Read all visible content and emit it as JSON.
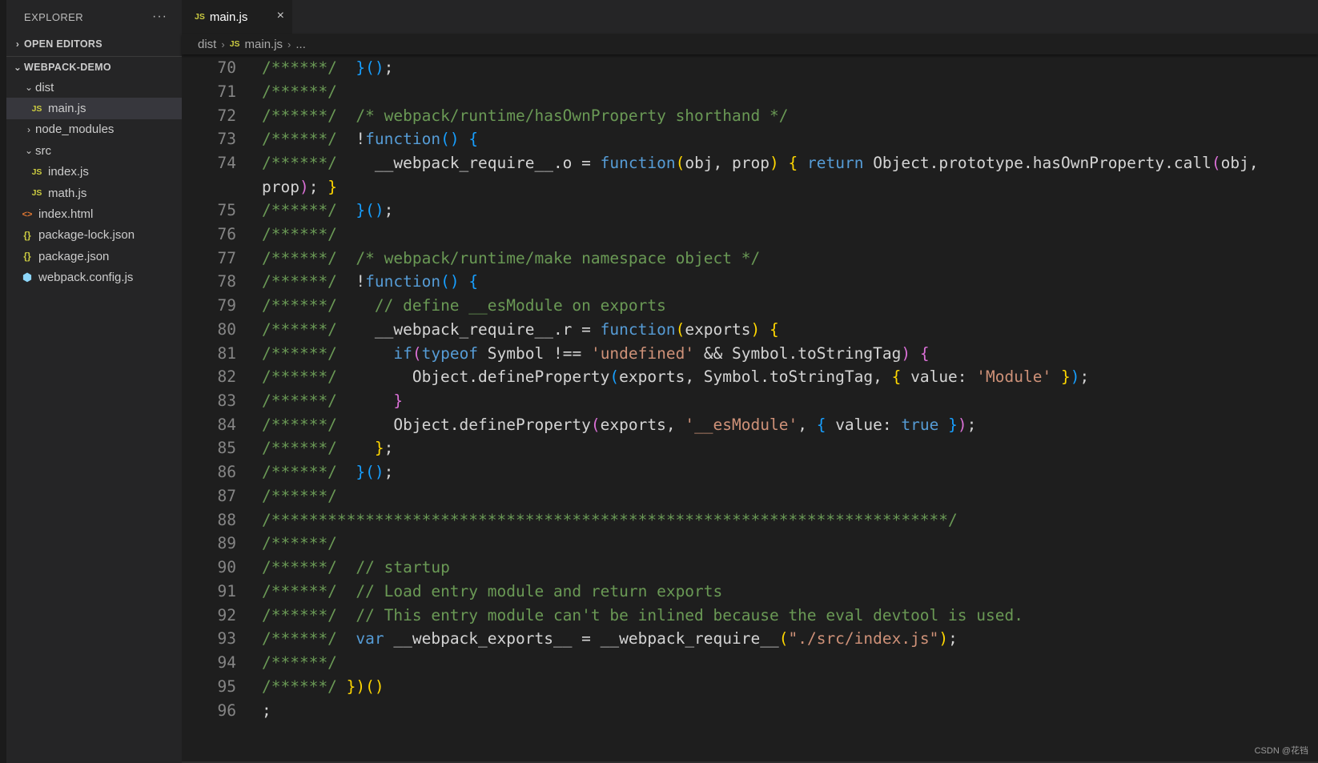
{
  "sidebar": {
    "title": "EXPLORER",
    "more": "···",
    "open_editors": "OPEN EDITORS",
    "project": "WEBPACK-DEMO",
    "tree": [
      {
        "label": "dist",
        "kind": "folder-open"
      },
      {
        "label": "main.js",
        "kind": "js"
      },
      {
        "label": "node_modules",
        "kind": "folder-closed"
      },
      {
        "label": "src",
        "kind": "folder-open"
      },
      {
        "label": "index.js",
        "kind": "js"
      },
      {
        "label": "math.js",
        "kind": "js"
      },
      {
        "label": "index.html",
        "kind": "html"
      },
      {
        "label": "package-lock.json",
        "kind": "json"
      },
      {
        "label": "package.json",
        "kind": "json"
      },
      {
        "label": "webpack.config.js",
        "kind": "webpack"
      }
    ]
  },
  "tab": {
    "icon": "JS",
    "label": "main.js",
    "close": "×"
  },
  "breadcrumb": {
    "folder": "dist",
    "icon": "JS",
    "file": "main.js",
    "more": "..."
  },
  "editor": {
    "line_numbers": [
      "70",
      "71",
      "72",
      "73",
      "74",
      "75",
      "76",
      "77",
      "78",
      "79",
      "80",
      "81",
      "82",
      "83",
      "84",
      "85",
      "86",
      "87",
      "88",
      "89",
      "90",
      "91",
      "92",
      "93",
      "94",
      "95",
      "96"
    ]
  },
  "watermark": "CSDN @花铛",
  "colors": {
    "comment": "#6a9955",
    "keyword": "#569cd6",
    "string": "#ce9178",
    "bracket_gold": "#ffd700",
    "bracket_magenta": "#da70d6",
    "bracket_blue": "#179fff"
  }
}
